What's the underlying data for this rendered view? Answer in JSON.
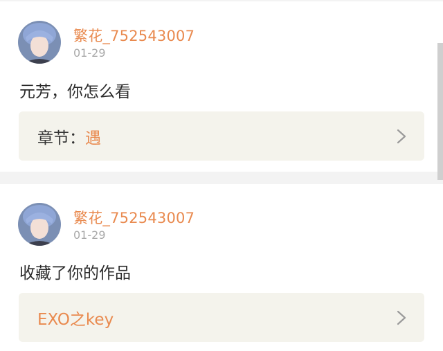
{
  "posts": [
    {
      "username": "繁花_752543007",
      "time": "01-29",
      "message": "元芳，你怎么看",
      "ref_label": "章节：",
      "ref_value": "遇"
    },
    {
      "username": "繁花_752543007",
      "time": "01-29",
      "message": "收藏了你的作品",
      "ref_label": "",
      "ref_value": "EXO之key"
    }
  ],
  "icons": {
    "avatar": "user-avatar",
    "chevron": "chevron-right-icon"
  },
  "colors": {
    "accent": "#e98a4f",
    "ref_background": "#f4f3ec",
    "page_background": "#f3f3f3"
  }
}
